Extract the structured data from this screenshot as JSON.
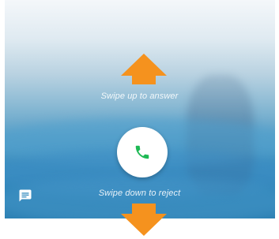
{
  "incoming_call": {
    "swipe_up_hint": "Swipe up to answer",
    "swipe_down_hint": "Swipe down to reject",
    "answer_icon": "phone-icon",
    "message_icon": "message-icon"
  },
  "colors": {
    "arrow": "#f5921e",
    "answer_icon": "#1db954",
    "answer_button_bg": "#ffffff",
    "hint_text": "#ffffff"
  }
}
